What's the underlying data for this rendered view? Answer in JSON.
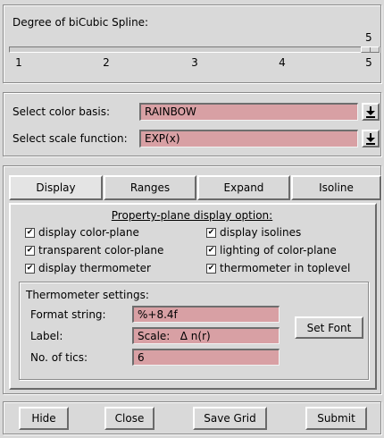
{
  "spline": {
    "title": "Degree of biCubic Spline:",
    "value": "5",
    "ticks": [
      "1",
      "2",
      "3",
      "4",
      "5"
    ],
    "level": {
      "min": 1,
      "max": 5,
      "current": 5
    }
  },
  "color_basis": {
    "label": "Select color basis:",
    "value": "RAINBOW"
  },
  "scale_function": {
    "label": "Select scale function:",
    "value": "EXP(x)"
  },
  "tabs": [
    {
      "label": "Display",
      "active": true
    },
    {
      "label": "Ranges",
      "active": false
    },
    {
      "label": "Expand",
      "active": false
    },
    {
      "label": "Isoline",
      "active": false
    }
  ],
  "display_panel": {
    "heading": "Property-plane display option:",
    "options": [
      {
        "label": "display color-plane",
        "checked": true
      },
      {
        "label": "display isolines",
        "checked": true
      },
      {
        "label": "transparent color-plane",
        "checked": true
      },
      {
        "label": "lighting of color-plane",
        "checked": true
      },
      {
        "label": "display thermometer",
        "checked": true
      },
      {
        "label": "thermometer in toplevel",
        "checked": true
      }
    ],
    "check_glyph": "✔"
  },
  "thermometer": {
    "heading": "Thermometer settings:",
    "format_label": "Format string:",
    "format_value": "%+8.4f",
    "label_label": "Label:",
    "label_value": "Scale:   Δ n(r)",
    "tics_label": "No. of tics:",
    "tics_value": "6",
    "set_font": "Set Font"
  },
  "buttons": {
    "hide": "Hide",
    "close": "Close",
    "save_grid": "Save Grid",
    "submit": "Submit"
  },
  "icons": {
    "dropdown": "dropdown-arrow-icon"
  },
  "colors": {
    "entry_bg": "#d8a0a4",
    "background": "#d9d9d9"
  }
}
